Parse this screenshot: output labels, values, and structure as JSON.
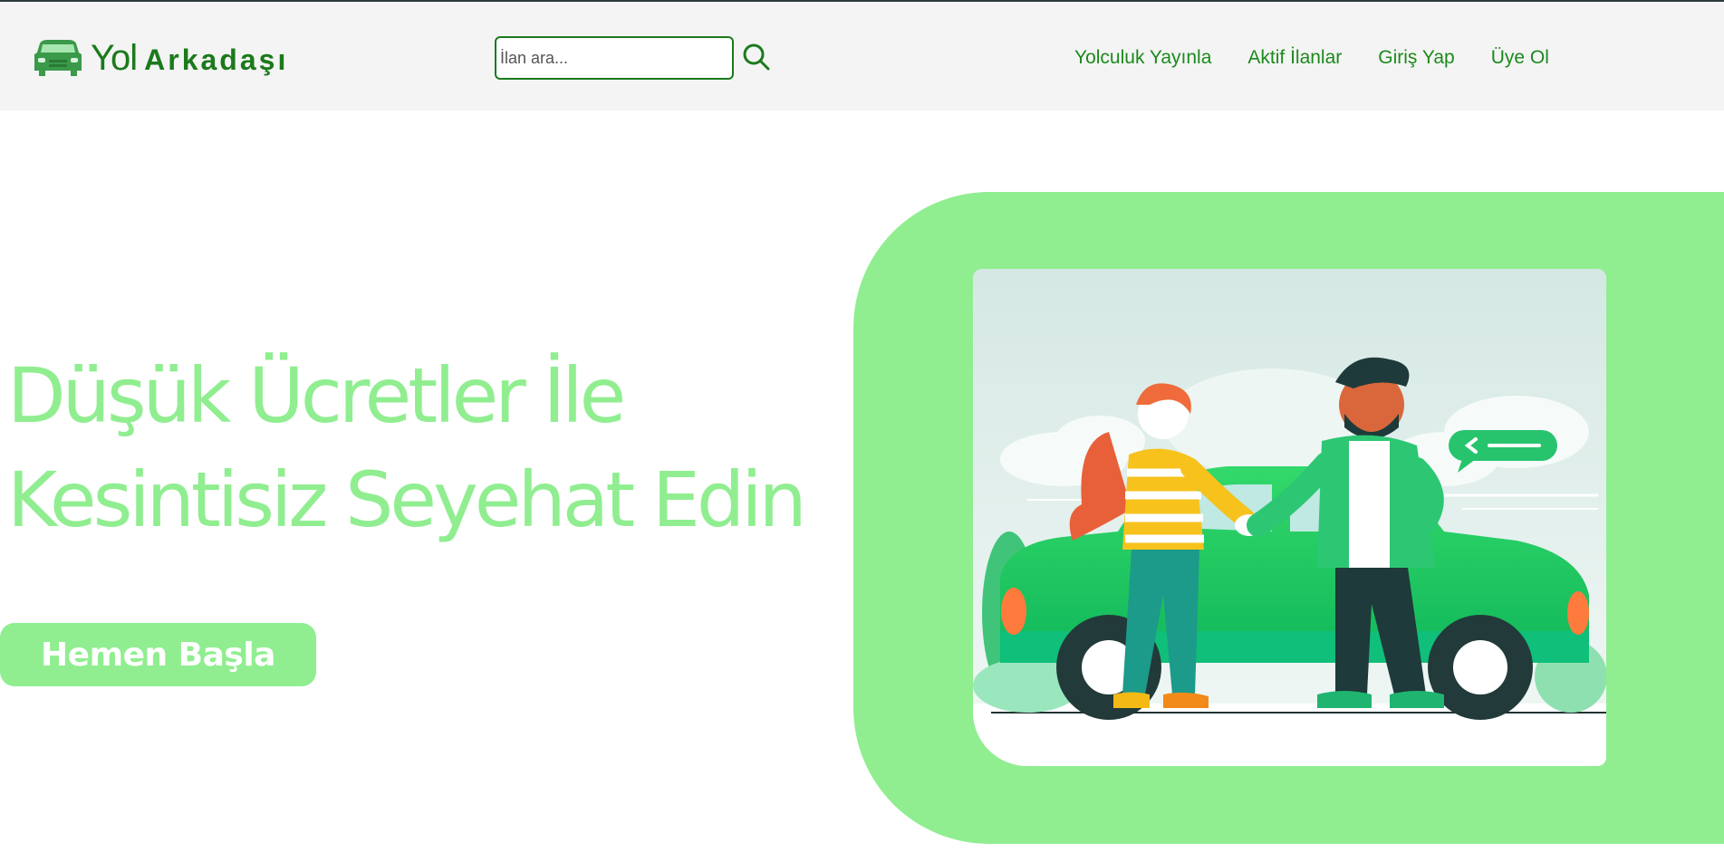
{
  "header": {
    "logo": {
      "icon": "car-icon",
      "word1": "Yol",
      "word2": "Arkadaşı"
    },
    "search": {
      "placeholder": "İlan ara...",
      "value": "",
      "icon": "search-icon"
    },
    "nav": [
      {
        "label": "Yolculuk Yayınla"
      },
      {
        "label": "Aktif İlanlar"
      },
      {
        "label": "Giriş Yap"
      },
      {
        "label": "Üye Ol"
      }
    ]
  },
  "hero": {
    "title_line1": "Düşük Ücretler İle",
    "title_line2": "Kesintisiz Seyehat Edin",
    "cta_label": "Hemen Başla",
    "illustration": "handshake-car-illustration"
  },
  "colors": {
    "brand": "#1b7a1b",
    "accent": "#90ee90",
    "header_bg": "#f4f4f4"
  }
}
